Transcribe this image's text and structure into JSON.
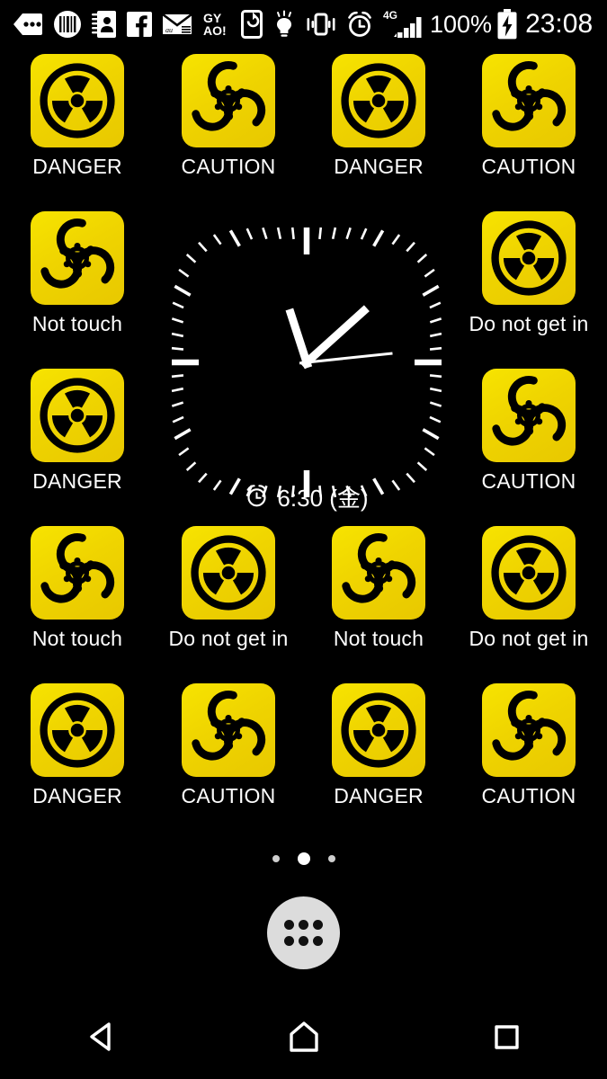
{
  "status_bar": {
    "icons": [
      {
        "name": "messages-icon",
        "label": "messages"
      },
      {
        "name": "barcode-circle-icon",
        "label": "barcode reader"
      },
      {
        "name": "contacts-book-icon",
        "label": "contacts"
      },
      {
        "name": "facebook-icon",
        "label": "Facebook"
      },
      {
        "name": "email-icon",
        "label": "au mail"
      },
      {
        "name": "gyao-icon",
        "label": "GYAO!"
      },
      {
        "name": "screen-rotate-icon",
        "label": "auto rotate"
      },
      {
        "name": "light-bulb-icon",
        "label": "flashlight"
      },
      {
        "name": "vibrate-icon",
        "label": "vibrate mode"
      },
      {
        "name": "alarm-clock-icon",
        "label": "alarm set"
      },
      {
        "name": "signal-4g-icon",
        "label": "4G signal"
      }
    ],
    "gyao_line1": "GY",
    "gyao_line2": "AO!",
    "network_label": "4G",
    "battery_percent": "100%",
    "clock": "23:08"
  },
  "home": {
    "apps": [
      {
        "label": "DANGER",
        "icon": "radiation-icon"
      },
      {
        "label": "CAUTION",
        "icon": "biohazard-icon"
      },
      {
        "label": "DANGER",
        "icon": "radiation-icon"
      },
      {
        "label": "CAUTION",
        "icon": "biohazard-icon"
      },
      {
        "label": "Not touch",
        "icon": "biohazard-icon"
      },
      {
        "label": "Do not get in",
        "icon": "radiation-icon"
      },
      {
        "label": "DANGER",
        "icon": "radiation-icon"
      },
      {
        "label": "CAUTION",
        "icon": "biohazard-icon"
      },
      {
        "label": "Not touch",
        "icon": "biohazard-icon"
      },
      {
        "label": "Do not get in",
        "icon": "radiation-icon"
      },
      {
        "label": "Not touch",
        "icon": "biohazard-icon"
      },
      {
        "label": "Do not get in",
        "icon": "radiation-icon"
      },
      {
        "label": "DANGER",
        "icon": "radiation-icon"
      },
      {
        "label": "CAUTION",
        "icon": "biohazard-icon"
      },
      {
        "label": "DANGER",
        "icon": "radiation-icon"
      },
      {
        "label": "CAUTION",
        "icon": "biohazard-icon"
      }
    ],
    "icon_color_yellow": "#efd400",
    "icon_color_symbol": "#000000",
    "label_color": "#ffffff"
  },
  "clock_widget": {
    "type": "analog",
    "hour_hand_deg": -18,
    "minute_hand_deg": 48,
    "second_hand_deg": 84,
    "displayed_time": "23:08",
    "alarm_icon": "alarm-clock-icon",
    "alarm_text": "6:30 (金)"
  },
  "page_indicator": {
    "count": 3,
    "active_index": 1
  },
  "app_drawer": {
    "icon": "apps-grid-icon",
    "dot_count": 6
  },
  "nav_bar": {
    "back": {
      "name": "back-icon",
      "label": "Back"
    },
    "home": {
      "name": "home-icon",
      "label": "Home"
    },
    "recents": {
      "name": "recents-icon",
      "label": "Recent apps"
    }
  }
}
